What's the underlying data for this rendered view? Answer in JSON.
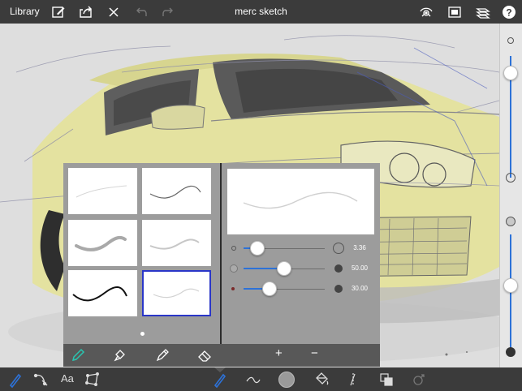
{
  "toolbar": {
    "library_label": "Library",
    "title": "merc sketch",
    "icons": [
      "new-sketch-icon",
      "share-icon",
      "close-icon",
      "undo-icon",
      "redo-icon",
      "visibility-icon",
      "canvas-icon",
      "layers-icon",
      "help-icon"
    ]
  },
  "brush_editor": {
    "presets": [
      "light-thin-stroke",
      "dark-thin-stroke",
      "soft-wide-stroke",
      "light-soft-stroke",
      "bold-ink-stroke",
      "faint-stroke-selected"
    ],
    "selected_preset": 6,
    "page_index": 1,
    "sliders": [
      {
        "name": "size",
        "value": "3.36",
        "fraction": 0.18
      },
      {
        "name": "opacity",
        "value": "50.00",
        "fraction": 0.5
      },
      {
        "name": "softness",
        "value": "30.00",
        "fraction": 0.3
      }
    ],
    "tools": [
      "pencil-icon",
      "marker-icon",
      "pen-icon",
      "eraser-icon"
    ],
    "add_label": "+",
    "remove_label": "−"
  },
  "right_panel": {
    "brush_size_level": 0.75,
    "opacity_level": 0.88
  },
  "bottom_toolbar": {
    "text_tool_label": "Aa",
    "current_color": "#9a9a9a",
    "accent": "#2d72d8"
  }
}
